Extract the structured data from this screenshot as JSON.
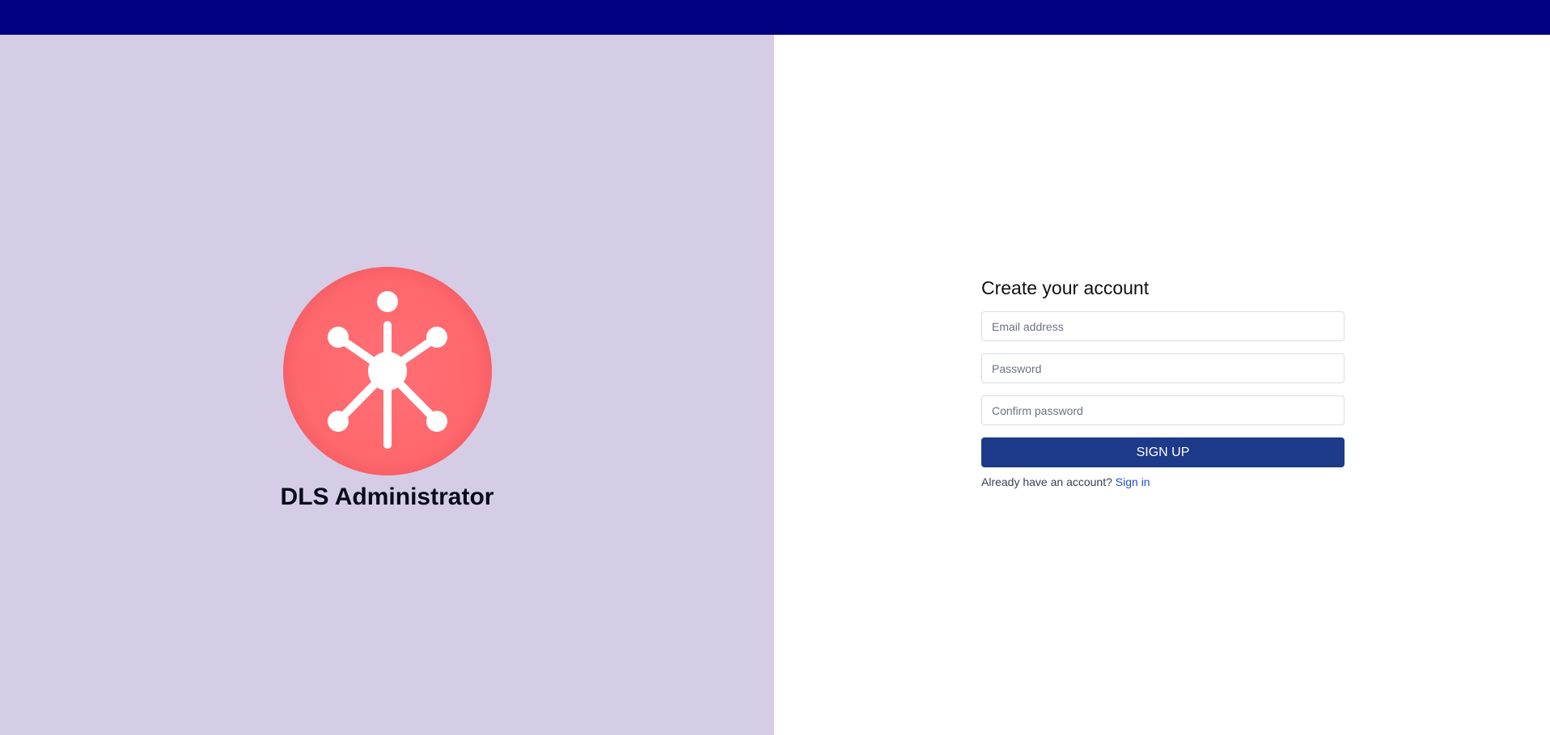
{
  "colors": {
    "top_bar": "#000080",
    "left_panel": "#d5cde6",
    "logo_circle": "#ff6b6b",
    "button": "#1e3a8a",
    "link": "#1d4ed8"
  },
  "brand": {
    "logo_icon": "network-hub-icon",
    "title": "DLS Administrator"
  },
  "form": {
    "title": "Create your account",
    "email_placeholder": "Email address",
    "password_placeholder": "Password",
    "confirm_placeholder": "Confirm password",
    "submit_label": "SIGN UP",
    "signin_prompt": "Already have an account?",
    "signin_link": "Sign in"
  }
}
